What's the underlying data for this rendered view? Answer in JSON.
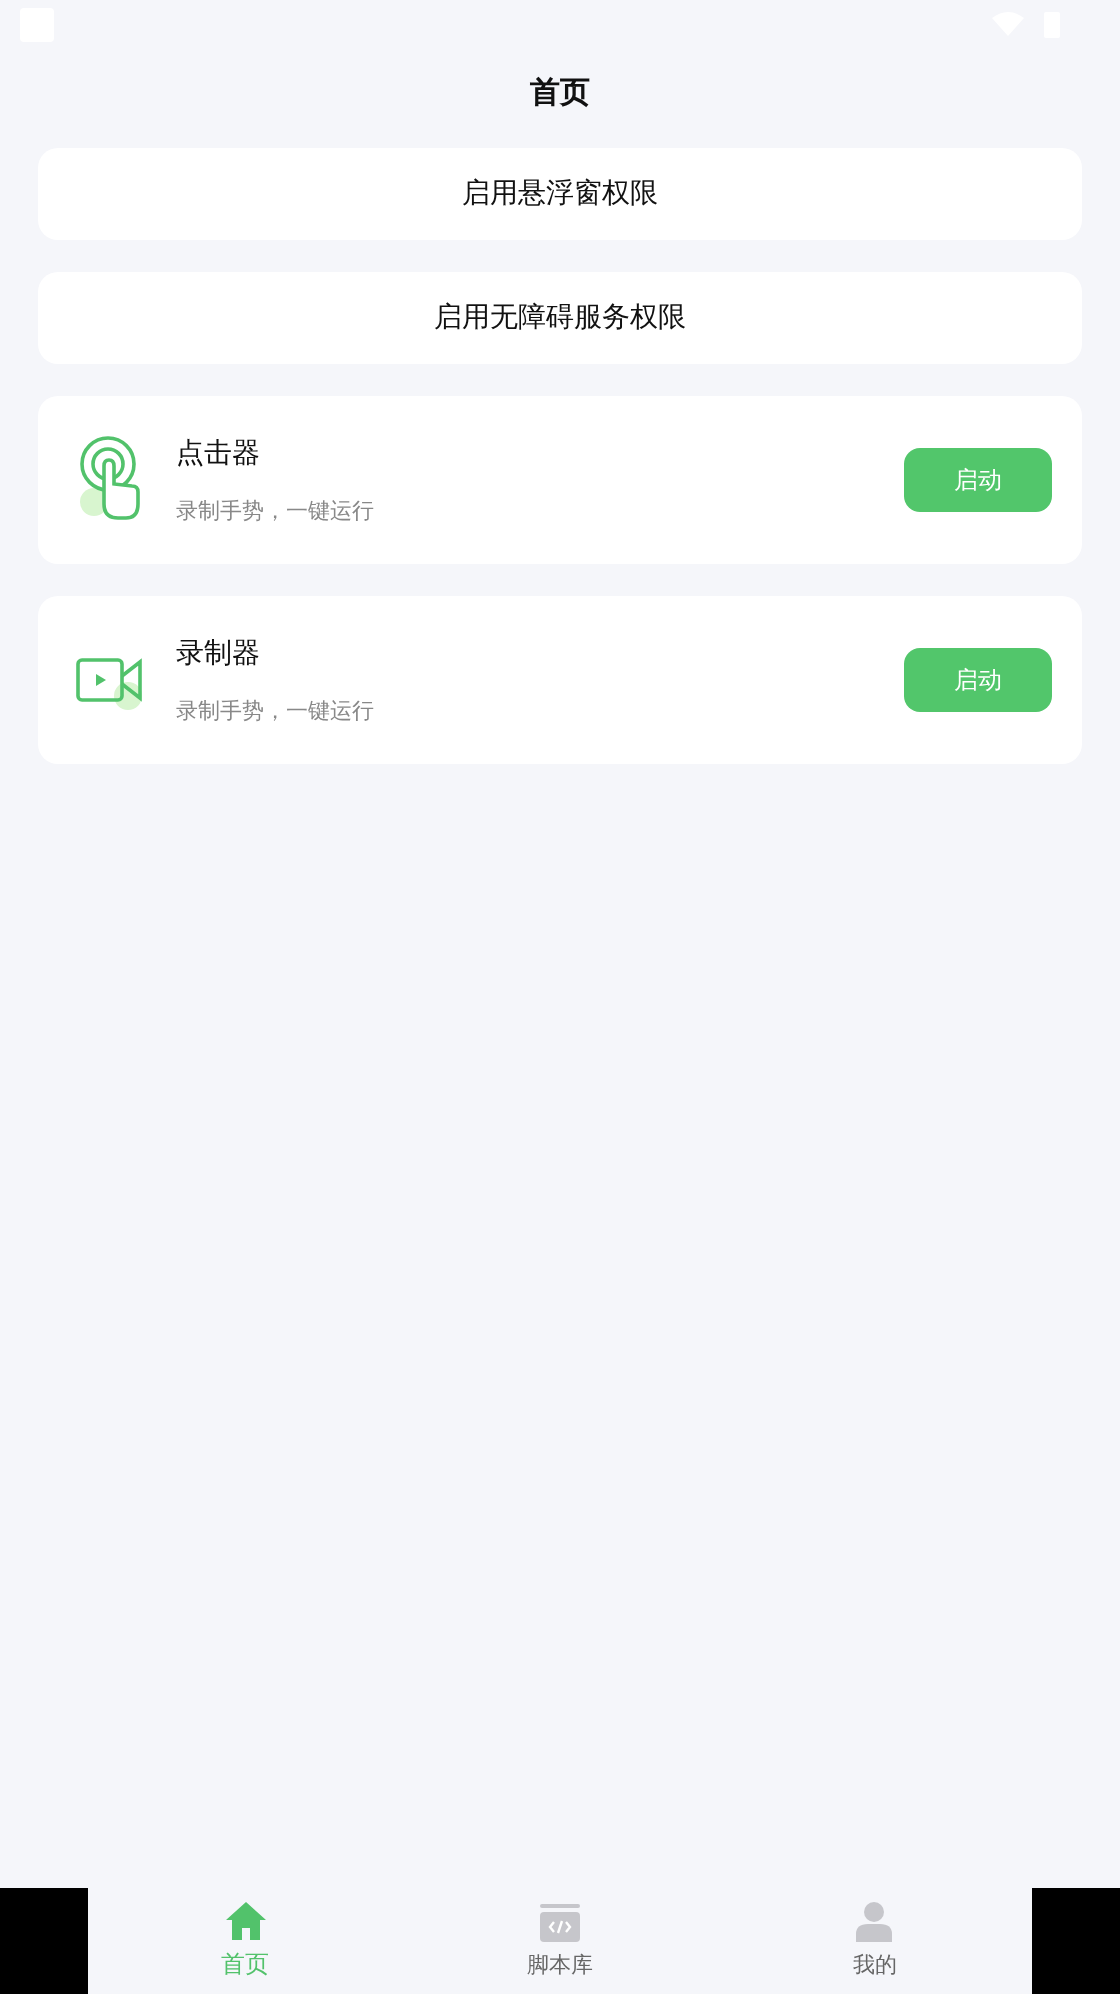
{
  "title": "首页",
  "permissions": [
    {
      "label": "启用悬浮窗权限"
    },
    {
      "label": "启用无障碍服务权限"
    }
  ],
  "tools": [
    {
      "kind": "clicker",
      "name": "点击器",
      "desc": "录制手势，一键运行",
      "button": "启动"
    },
    {
      "kind": "recorder",
      "name": "录制器",
      "desc": "录制手势，一键运行",
      "button": "启动"
    }
  ],
  "tabs": [
    {
      "kind": "home",
      "label": "首页",
      "selected": true
    },
    {
      "kind": "scripts",
      "label": "脚本库",
      "selected": false
    },
    {
      "kind": "profile",
      "label": "我的",
      "selected": false
    }
  ]
}
